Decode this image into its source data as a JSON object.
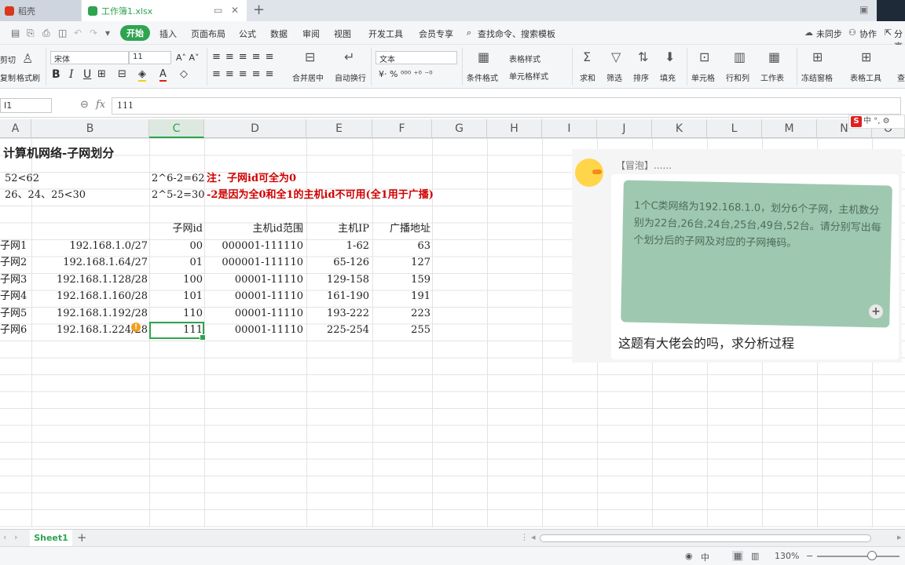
{
  "titlebar": {
    "tabs": [
      {
        "label": "稻壳",
        "icon": "docer-icon"
      },
      {
        "label": "工作簿1.xlsx",
        "icon": "spreadsheet-icon"
      }
    ],
    "new_tab": "+"
  },
  "menu": {
    "items": [
      "开始",
      "插入",
      "页面布局",
      "公式",
      "数据",
      "审阅",
      "视图",
      "开发工具",
      "会员专享"
    ],
    "search": "查找命令、搜索模板",
    "right": [
      "未同步",
      "协作",
      "分享"
    ]
  },
  "ribbon": {
    "cut": "剪切",
    "format_painter": "格式刷",
    "paste": "复制",
    "font_name": "宋体",
    "font_size": "11",
    "number_format": "文本",
    "merge": "合并居中",
    "wrap": "自动换行",
    "cond_format": "条件格式",
    "table_style": "表格样式",
    "cell_style": "单元格样式",
    "sum": "求和",
    "filter": "筛选",
    "sort": "排序",
    "fill": "填充",
    "cell": "单元格",
    "rowcol": "行和列",
    "worksheet": "工作表",
    "freeze": "冻结窗格",
    "table_tools": "表格工具",
    "find": "查"
  },
  "formula_bar": {
    "name_box": "I1",
    "fx": "fx",
    "value": "111"
  },
  "columns": [
    "A",
    "B",
    "C",
    "D",
    "E",
    "F",
    "G",
    "H",
    "I",
    "J",
    "K",
    "L",
    "M",
    "N",
    "O"
  ],
  "sheet": {
    "title": "计算机网络-子网划分",
    "row2": {
      "a": "52<62",
      "c": "2^6-2=62",
      "note": "注：子网id可全为0"
    },
    "row3": {
      "a": "26、24、25<30",
      "c": "2^5-2=30",
      "note": "-2是因为全0和全1的主机id不可用(全1用于广播)"
    },
    "headers": {
      "c": "子网id",
      "d": "主机id范围",
      "e": "主机IP",
      "f": "广播地址"
    },
    "rows": [
      {
        "a": "子网1",
        "b": "192.168.1.0/27",
        "c": "00",
        "d": "000001-111110",
        "e": "1-62",
        "f": "63"
      },
      {
        "a": "子网2",
        "b": "192.168.1.64/27",
        "c": "01",
        "d": "000001-111110",
        "e": "65-126",
        "f": "127"
      },
      {
        "a": "子网3",
        "b": "192.168.1.128/28",
        "c": "100",
        "d": "00001-11110",
        "e": "129-158",
        "f": "159"
      },
      {
        "a": "子网4",
        "b": "192.168.1.160/28",
        "c": "101",
        "d": "00001-11110",
        "e": "161-190",
        "f": "191"
      },
      {
        "a": "子网5",
        "b": "192.168.1.192/28",
        "c": "110",
        "d": "00001-11110",
        "e": "193-222",
        "f": "223"
      },
      {
        "a": "子网6",
        "b": "192.168.1.224/28",
        "c": "111",
        "d": "00001-11110",
        "e": "225-254",
        "f": "255"
      }
    ]
  },
  "chat": {
    "sender": "【冒泡】......",
    "photo_text": "1个C类网络为192.168.1.0，划分6个子网，主机数分别为22台,26台,24台,25台,49台,52台。请分别写出每个划分后的子网及对应的子网掩码。",
    "question": "这题有大佬会的吗，求分析过程"
  },
  "ime": {
    "label": "中",
    "extra": "°,"
  },
  "sheet_tabs": {
    "active": "Sheet1",
    "add": "+"
  },
  "status": {
    "zoom": "130%",
    "input_mode": "中"
  }
}
